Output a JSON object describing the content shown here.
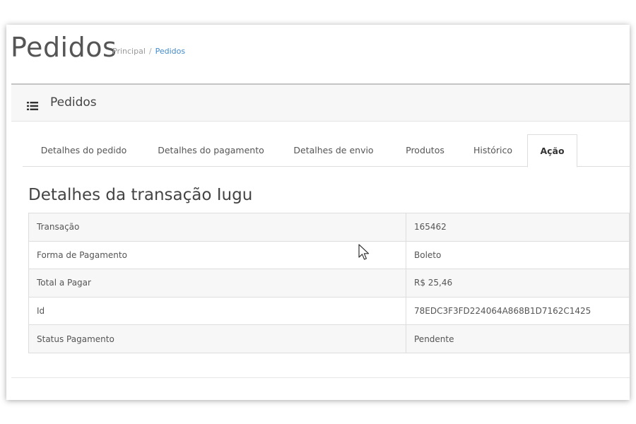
{
  "header": {
    "title": "Pedidos",
    "breadcrumb": {
      "home": "Principal",
      "separator": "/",
      "current": "Pedidos"
    }
  },
  "box": {
    "icon": "list-icon",
    "title": "Pedidos"
  },
  "tabs": [
    {
      "label": "Detalhes do pedido",
      "active": false
    },
    {
      "label": "Detalhes do pagamento",
      "active": false
    },
    {
      "label": "Detalhes de envio",
      "active": false
    },
    {
      "label": "Produtos",
      "active": false
    },
    {
      "label": "Histórico",
      "active": false
    },
    {
      "label": "Ação",
      "active": true
    }
  ],
  "section": {
    "title": "Detalhes da transação Iugu"
  },
  "details": {
    "rows": [
      {
        "label": "Transação",
        "value": "165462"
      },
      {
        "label": "Forma de Pagamento",
        "value": "Boleto"
      },
      {
        "label": "Total a Pagar",
        "value": "R$ 25,46"
      },
      {
        "label": "Id",
        "value": "78EDC3F3FD224064A868B1D7162C1425"
      },
      {
        "label": "Status Pagamento",
        "value": "Pendente"
      }
    ]
  },
  "colors": {
    "link": "#428bca",
    "title": "#555555",
    "border": "#dddddd",
    "stripe": "#f7f7f7"
  }
}
